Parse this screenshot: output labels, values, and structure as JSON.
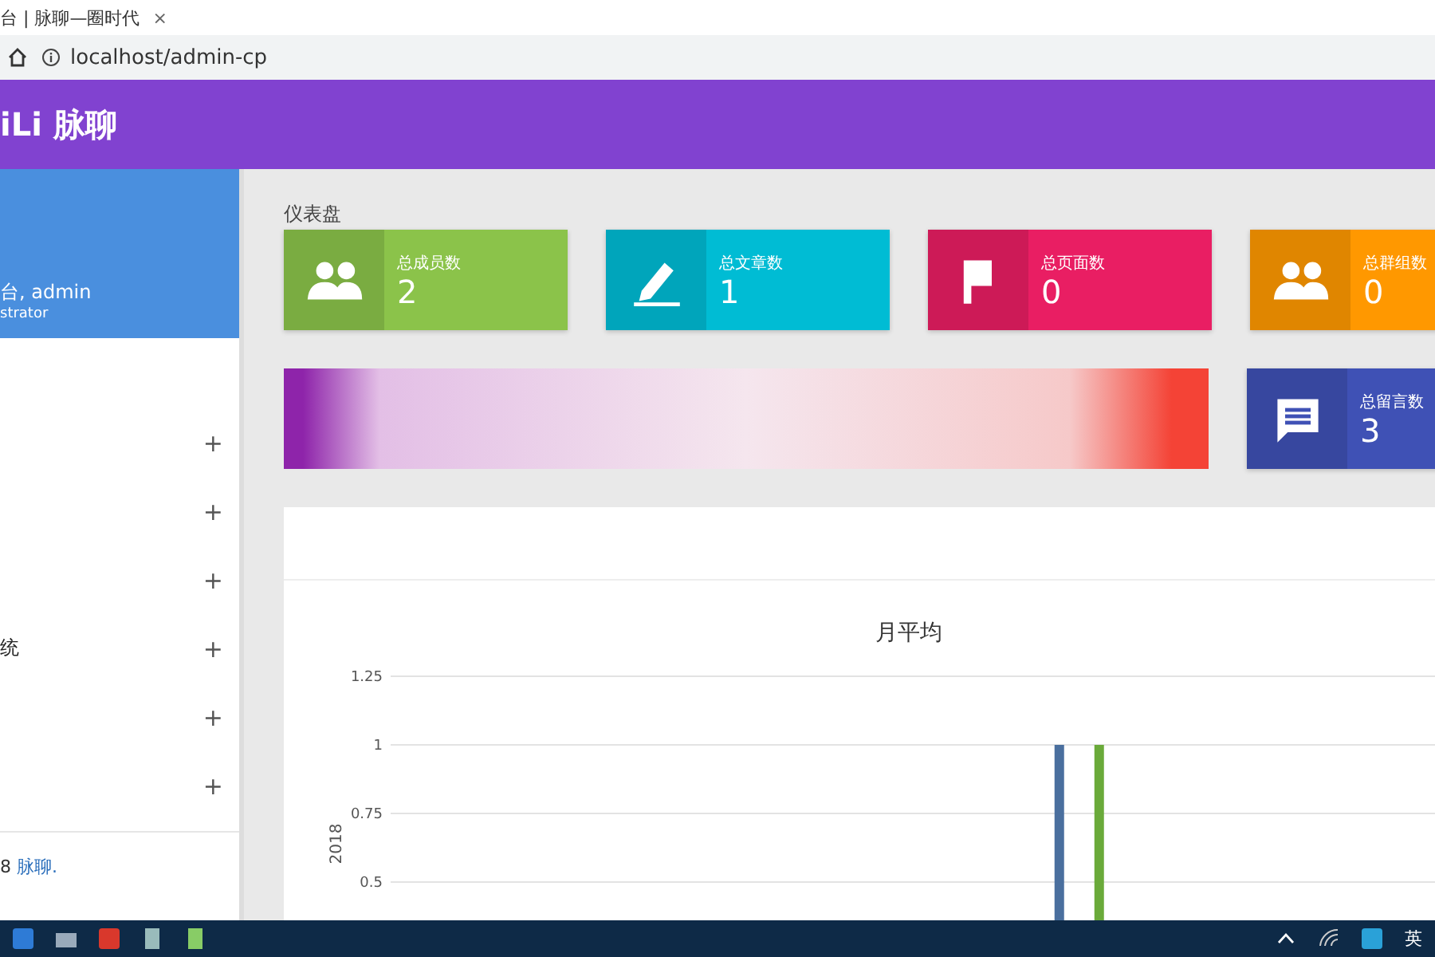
{
  "browser": {
    "tab_title": "台 | 脉聊—圈时代",
    "address": "localhost/admin-cp",
    "tab_close": "×"
  },
  "header": {
    "brand": "iLi 脉聊"
  },
  "sidebar": {
    "greeting": "台, admin",
    "role": "strator",
    "items": [
      {
        "toggle": "+"
      },
      {
        "toggle": "+"
      },
      {
        "toggle": "+"
      },
      {
        "label": "统",
        "toggle": "+"
      },
      {
        "toggle": "+"
      },
      {
        "toggle": "+"
      }
    ],
    "footer": {
      "text": "8",
      "link": "脉聊."
    }
  },
  "page_title": "仪表盘",
  "stat_cards": [
    {
      "kind": "people",
      "color": "#8bc34a",
      "label": "总成员数",
      "value": "2"
    },
    {
      "kind": "pencil",
      "color": "#00bcd4",
      "label": "总文章数",
      "value": "1"
    },
    {
      "kind": "flag",
      "color": "#e91e63",
      "label": "总页面数",
      "value": "0"
    },
    {
      "kind": "people",
      "color": "#ff9800",
      "label": "总群组数",
      "value": "0"
    }
  ],
  "message_card": {
    "kind": "message",
    "color": "#3f51b5",
    "label": "总留言数",
    "value": "3"
  },
  "chart_panel": {
    "chart_data": {
      "type": "bar",
      "title": "月平均",
      "ylabel": "2018",
      "ylim": [
        0.5,
        1.25
      ],
      "yticks": [
        0.5,
        0.75,
        1,
        1.25
      ],
      "series": [
        {
          "color": "#4a6f9e",
          "values": [
            null,
            null,
            null,
            null,
            null,
            1,
            null,
            null
          ]
        },
        {
          "color": "#6aaa3a",
          "values": [
            null,
            null,
            null,
            null,
            null,
            1,
            null,
            null
          ]
        }
      ]
    }
  },
  "taskbar": {
    "input_indicator": "英"
  }
}
